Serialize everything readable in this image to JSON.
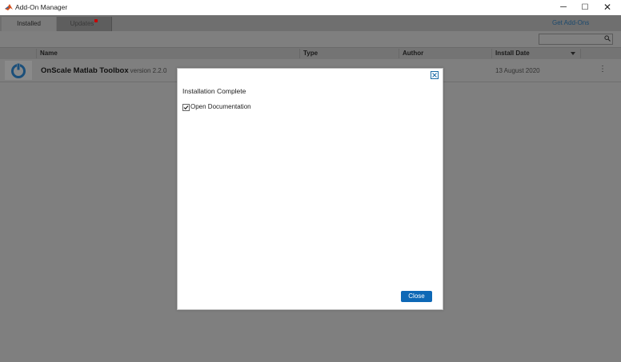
{
  "window": {
    "title": "Add-On Manager",
    "controls": {
      "minimize": "─",
      "maximize": "☐",
      "close": "✕"
    }
  },
  "tabs": [
    {
      "label": "Installed",
      "active": true
    },
    {
      "label": "Updates",
      "active": false,
      "badge": true
    }
  ],
  "header": {
    "get_addons_label": "Get Add-Ons"
  },
  "search": {
    "value": "",
    "icon": "search-icon"
  },
  "table": {
    "columns": [
      "Name",
      "Type",
      "Author",
      "Install Date"
    ],
    "sort_column": "Install Date",
    "rows": [
      {
        "icon": "onscale-power-icon",
        "name": "OnScale Matlab Toolbox",
        "version": "version 2.2.0",
        "type": "",
        "author": "",
        "install_date": "13 August 2020",
        "menu": "⋮"
      }
    ]
  },
  "modal": {
    "heading": "Installation Complete",
    "checkbox_label": "Open Documentation",
    "checkbox_checked": true,
    "close_label": "Close"
  },
  "colors": {
    "accent": "#0e68b6",
    "badge": "#c80000",
    "icon_blue": "#1b6aa5"
  }
}
